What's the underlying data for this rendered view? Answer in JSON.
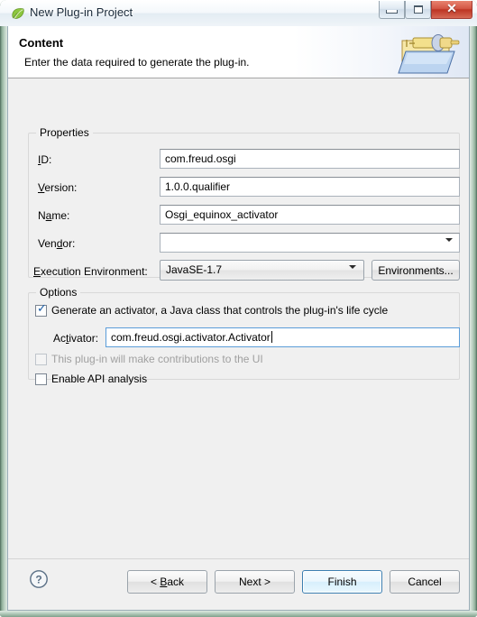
{
  "window": {
    "title": "New Plug-in Project",
    "icon": "leaf-icon",
    "controls": {
      "minimize": "Minimize",
      "maximize": "Maximize",
      "close": "Close"
    }
  },
  "banner": {
    "title": "Content",
    "description": "Enter the data required to generate the plug-in.",
    "image": "plugin-project-banner-icon"
  },
  "properties": {
    "group_label": "Properties",
    "fields": [
      {
        "label": "ID:",
        "mnemonic": "I",
        "value": "com.freud.osgi",
        "type": "text"
      },
      {
        "label": "Version:",
        "mnemonic": "V",
        "value": "1.0.0.qualifier",
        "type": "text"
      },
      {
        "label": "Name:",
        "mnemonic": "a",
        "value": "Osgi_equinox_activator",
        "type": "text"
      },
      {
        "label": "Vendor:",
        "mnemonic": "d",
        "value": "",
        "type": "combo-editable"
      }
    ],
    "execution_environment": {
      "label": "Execution Environment:",
      "mnemonic": "E",
      "value": "JavaSE-1.7",
      "button": "Environments..."
    }
  },
  "options": {
    "group_label": "Options",
    "generate_activator": {
      "label": "Generate an activator, a Java class that controls the plug-in's life cycle",
      "checked": true,
      "enabled": true
    },
    "activator": {
      "label": "Activator:",
      "value": "com.freud.osgi.activator.Activator",
      "focused": true
    },
    "ui_contributions": {
      "label": "This plug-in will make contributions to the UI",
      "checked": false,
      "enabled": false
    },
    "api_analysis": {
      "label": "Enable API analysis",
      "checked": false,
      "enabled": true
    }
  },
  "footer": {
    "help": "?",
    "buttons": [
      {
        "label": "< Back",
        "default": false
      },
      {
        "label": "Next >",
        "default": false
      },
      {
        "label": "Finish",
        "default": true
      },
      {
        "label": "Cancel",
        "default": false
      }
    ]
  },
  "colors": {
    "accent": "#3c7fb1",
    "window_border": "#8fae99",
    "close_button": "#bd3423",
    "check_mark": "#1c5ea8",
    "body_background": "#f0f0f0"
  }
}
